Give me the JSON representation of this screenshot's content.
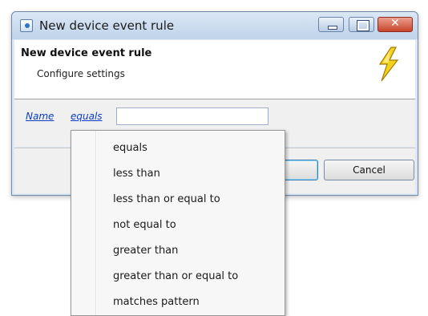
{
  "window": {
    "title": "New device event rule",
    "controls": {
      "close": "✕"
    }
  },
  "header": {
    "title": "New device event rule",
    "subtitle": "Configure settings",
    "icon": "lightning-bolt-icon"
  },
  "rule": {
    "field_link": "Name",
    "operator_link": "equals",
    "value": ""
  },
  "buttons": {
    "ok_label": "",
    "cancel_label": "Cancel"
  },
  "operator_menu": {
    "items": [
      "equals",
      "less than",
      "less than or equal to",
      "not equal to",
      "greater than",
      "greater than or equal to",
      "matches pattern"
    ]
  }
}
